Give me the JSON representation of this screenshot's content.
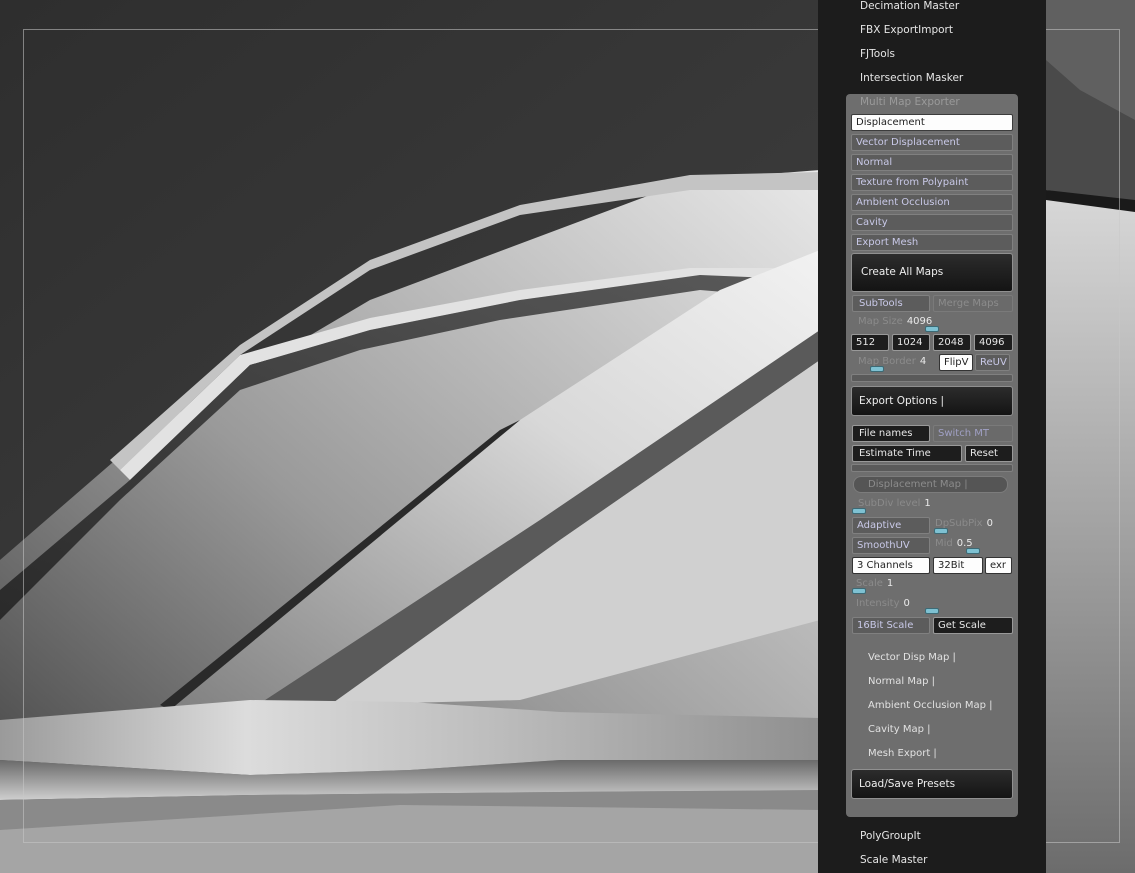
{
  "menu": {
    "top_items": [
      "Decimation Master",
      "FBX ExportImport",
      "FJTools",
      "Intersection Masker"
    ],
    "bottom_items": [
      "PolyGroupIt",
      "Scale Master"
    ]
  },
  "mme": {
    "title": "Multi Map Exporter",
    "map_buttons": [
      "Displacement",
      "Vector Displacement",
      "Normal",
      "Texture from Polypaint",
      "Ambient Occlusion",
      "Cavity",
      "Export Mesh"
    ],
    "create_all_maps": "Create All Maps",
    "subtools": "SubTools",
    "merge_maps": "Merge Maps",
    "map_size_label": "Map Size",
    "map_size_value": "4096",
    "map_size_fraction": 0.5,
    "sizes": [
      "512",
      "1024",
      "2048",
      "4096"
    ],
    "map_border_label": "Map Border",
    "map_border_value": "4",
    "flipv": "FlipV",
    "reuv": "ReUV",
    "export_options": "Export Options |",
    "file_names": "File names",
    "switch_mt": "Switch MT",
    "estimate_time": "Estimate Time",
    "reset": "Reset",
    "disp": {
      "header": "Displacement Map |",
      "subdiv_label": "SubDiv level",
      "subdiv_value": "1",
      "adaptive": "Adaptive",
      "dpsubpix_label": "DpSubPix",
      "dpsubpix_value": "0",
      "smoothuv": "SmoothUV",
      "mid_label": "Mid",
      "mid_value": "0.5",
      "channels": "3 Channels",
      "bits": "32Bit",
      "format": "exr",
      "scale_label": "Scale",
      "scale_value": "1",
      "intensity_label": "Intensity",
      "intensity_value": "0",
      "bit16_scale": "16Bit Scale",
      "get_scale": "Get Scale"
    },
    "sections": [
      "Vector Disp Map |",
      "Normal Map |",
      "Ambient Occlusion Map |",
      "Cavity Map |",
      "Mesh Export |"
    ],
    "load_save_presets": "Load/Save Presets"
  }
}
